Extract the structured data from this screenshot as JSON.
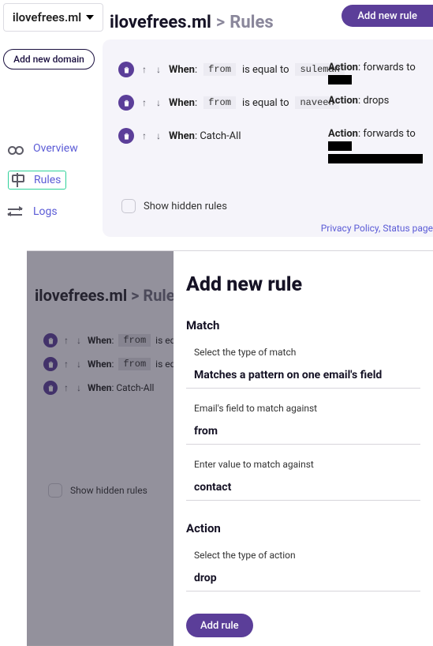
{
  "domain": {
    "current": "ilovefrees.ml",
    "add_domain_label": "Add new domain"
  },
  "sidebar": {
    "items": [
      {
        "label": "Overview"
      },
      {
        "label": "Rules"
      },
      {
        "label": "Logs"
      }
    ]
  },
  "header": {
    "crumb_domain": "ilovefrees.ml",
    "crumb_sep": ">",
    "crumb_page": "Rules",
    "add_rule_label": "Add new rule"
  },
  "rules": [
    {
      "when_label": "When",
      "field": "from",
      "op": "is equal to",
      "value": "suleman",
      "action_label": "Action",
      "action": "forwards to"
    },
    {
      "when_label": "When",
      "field": "from",
      "op": "is equal to",
      "value": "naveen",
      "action_label": "Action",
      "action": "drops"
    },
    {
      "when_label": "When",
      "catch_all": "Catch-All",
      "action_label": "Action",
      "action": "forwards to"
    }
  ],
  "show_hidden_label": "Show hidden rules",
  "footer": {
    "privacy": "Privacy Policy",
    "sep": ",",
    "status": "Status page"
  },
  "dim": {
    "crumb_domain": "ilovefrees.ml",
    "crumb_sep": ">",
    "crumb_page": "Rules",
    "rules": [
      {
        "when_label": "When",
        "field": "from",
        "op": "is equal"
      },
      {
        "when_label": "When",
        "field": "from",
        "op": "is equal"
      },
      {
        "when_label": "When",
        "catch_all": "Catch-All"
      }
    ],
    "show_hidden_label": "Show hidden rules"
  },
  "modal": {
    "title": "Add new rule",
    "match": {
      "heading": "Match",
      "type_label": "Select the type of match",
      "type_value": "Matches a pattern on one email's field",
      "field_label": "Email's field to match against",
      "field_value": "from",
      "value_label": "Enter value to match against",
      "value_value": "contact"
    },
    "action": {
      "heading": "Action",
      "type_label": "Select the type of action",
      "type_value": "drop"
    },
    "submit_label": "Add rule"
  }
}
